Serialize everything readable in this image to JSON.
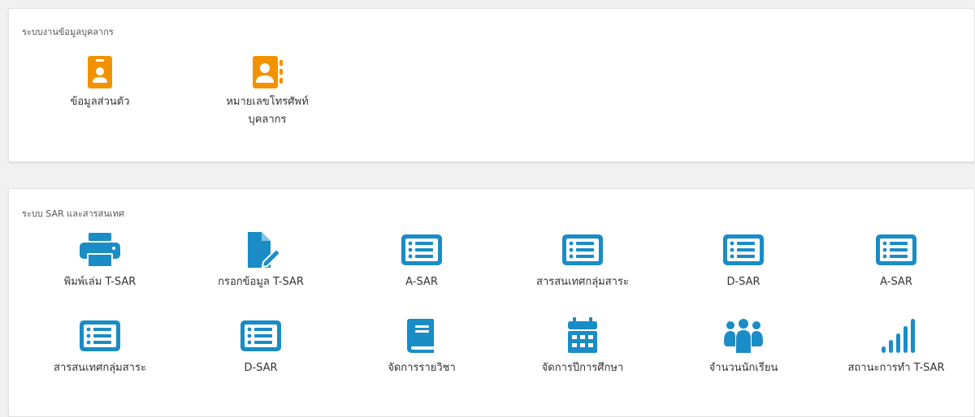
{
  "personnel_section": {
    "title": "ระบบงานข้อมูลบุคลากร",
    "tiles": [
      {
        "label": "ข้อมูลส่วนตัว",
        "icon": "id-badge-icon"
      },
      {
        "label": "หมายเลขโทรศัพท์",
        "label_line2": "บุคลากร",
        "icon": "address-book-icon"
      }
    ]
  },
  "sar_section": {
    "title": "ระบบ SAR และสารสนเทศ",
    "tiles": [
      {
        "label": "พิมพ์เล่ม T-SAR",
        "icon": "printer-icon"
      },
      {
        "label": "กรอกข้อมูล T-SAR",
        "icon": "file-edit-icon"
      },
      {
        "label": "A-SAR",
        "icon": "list-alt-icon"
      },
      {
        "label": "สารสนเทศกลุ่มสาระ",
        "icon": "list-alt-icon"
      },
      {
        "label": "D-SAR",
        "icon": "list-alt-icon"
      },
      {
        "label": "A-SAR",
        "icon": "list-alt-icon"
      },
      {
        "label": "สารสนเทศกลุ่มสาระ",
        "icon": "list-alt-icon"
      },
      {
        "label": "D-SAR",
        "icon": "list-alt-icon"
      },
      {
        "label": "จัดการรายวิชา",
        "icon": "book-icon"
      },
      {
        "label": "จัดการปีการศึกษา",
        "icon": "calendar-icon"
      },
      {
        "label": "จำนวนนักเรียน",
        "icon": "users-icon"
      },
      {
        "label": "สถานะการทำ T-SAR",
        "icon": "signal-bars-icon"
      }
    ]
  },
  "colors": {
    "orange": "#f39200",
    "blue": "#1a8cc6",
    "background": "#f1f1f1",
    "card": "#ffffff"
  }
}
